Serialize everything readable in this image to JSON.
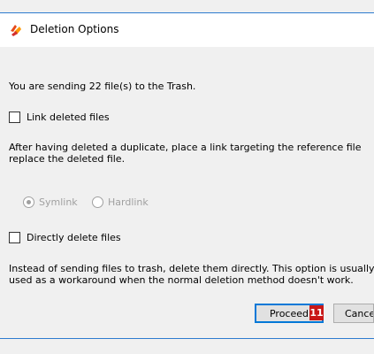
{
  "dialog": {
    "title": "Deletion Options",
    "message": "You are sending 22 file(s) to the Trash.",
    "link_checkbox_label": "Link deleted files",
    "link_description_line1": "After having deleted a duplicate, place a link targeting the reference file",
    "link_description_line2": "replace the deleted file.",
    "radio_symlink_label": "Symlink",
    "radio_hardlink_label": "Hardlink",
    "direct_delete_label": "Directly delete files",
    "direct_description_line1": "Instead of sending files to trash, delete them directly. This option is usually",
    "direct_description_line2": "used as a workaround when the normal deletion method doesn't work.",
    "proceed_button": "Proceed",
    "cancel_button": "Cancel",
    "badge_number": "11"
  },
  "state": {
    "link_deleted_files": false,
    "directly_delete_files": false,
    "selected_link_type": "Symlink"
  },
  "colors": {
    "accent": "#0078d7",
    "badge": "#c81818",
    "disabled_text": "#a0a0a0"
  },
  "icons": {
    "app_icon": "colorful-app-icon"
  }
}
